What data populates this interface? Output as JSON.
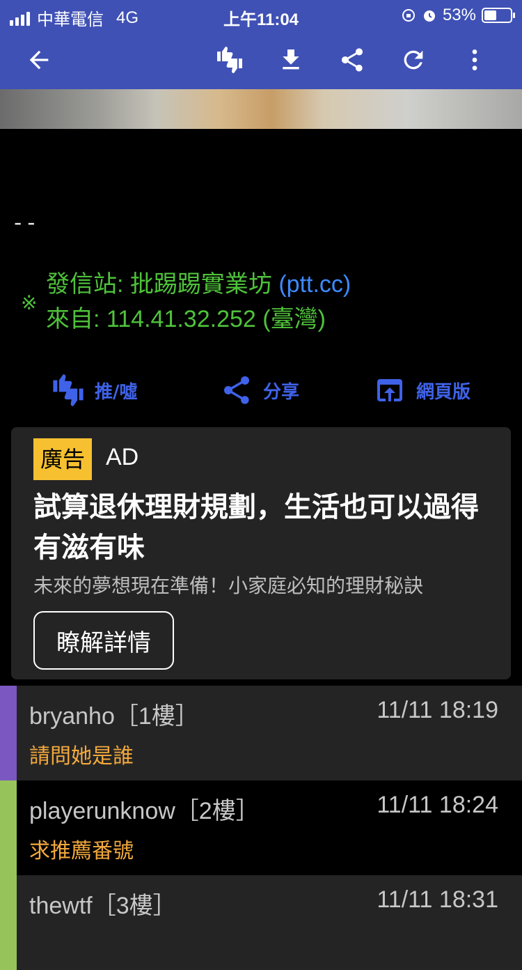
{
  "status_bar": {
    "carrier": "中華電信",
    "network": "4G",
    "time": "上午11:04",
    "battery": "53%",
    "battery_level": 0.53
  },
  "toolbar": {
    "icons": [
      "back-arrow-icon",
      "push-boo-icon",
      "download-icon",
      "share-icon",
      "refresh-icon",
      "more-vert-icon"
    ]
  },
  "post": {
    "separator": "--",
    "mark": "※",
    "origin_label": "發信站: 批踢踢實業坊",
    "origin_link": "(ptt.cc)",
    "from_line": "來自: 114.41.32.252 (臺灣)"
  },
  "actions": {
    "push_boo": "推/噓",
    "share": "分享",
    "web_version": "網頁版"
  },
  "ad": {
    "badge": "廣告",
    "tag": "AD",
    "title": "試算退休理財規劃，生活也可以過得有滋有味",
    "description": "未來的夢想現在準備！小家庭必知的理財秘訣",
    "button": "瞭解詳情"
  },
  "comments": [
    {
      "user": "bryanho［1樓］",
      "time": "11/11 18:19",
      "text": "請問她是誰",
      "accent": "#7b57c2",
      "bg": "#242424"
    },
    {
      "user": "playerunknow［2樓］",
      "time": "11/11 18:24",
      "text": "求推薦番號",
      "accent": "#97c45a",
      "bg": "#000000"
    },
    {
      "user": "thewtf［3樓］",
      "time": "11/11 18:31",
      "text": "",
      "accent": "#97c45a",
      "bg": "#242424"
    }
  ],
  "colors": {
    "primary": "#3f51b5",
    "accent_blue": "#3f62e8",
    "signature_green": "#4fc23b",
    "link_blue": "#3d8bff",
    "comment_text": "#f3a93c",
    "ad_badge": "#f6c030"
  }
}
